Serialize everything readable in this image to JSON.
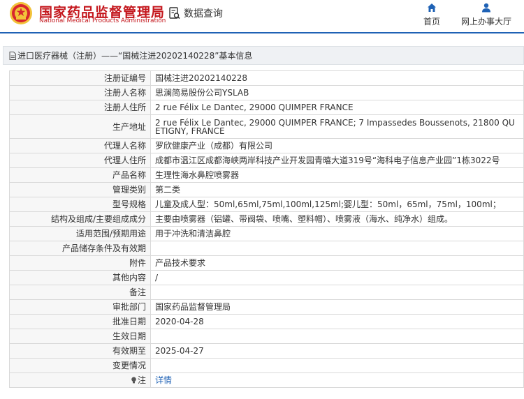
{
  "header": {
    "org_cn": "国家药品监督管理局",
    "org_en": "National Medical Products Administration",
    "query_label": "数据查询",
    "nav_home": "首页",
    "nav_service": "网上办事大厅",
    "accent_color": "#c4161c",
    "nav_color": "#1f62b5"
  },
  "titlebar": {
    "text": "进口医疗器械（注册）——“国械注进20202140228”基本信息"
  },
  "rows": [
    {
      "label": "注册证编号",
      "value": "国械注进20202140228"
    },
    {
      "label": "注册人名称",
      "value": "思澜简易股份公司YSLAB"
    },
    {
      "label": "注册人住所",
      "value": "2 rue Félix Le Dantec, 29000 QUIMPER FRANCE"
    },
    {
      "label": "生产地址",
      "value": "2 rue Félix Le Dantec, 29000 QUIMPER FRANCE; 7 Impassedes Boussenots, 21800 QUETIGNY, FRANCE"
    },
    {
      "label": "代理人名称",
      "value": "罗欣健康产业（成都）有限公司"
    },
    {
      "label": "代理人住所",
      "value": "成都市温江区成都海峡两岸科技产业开发园青暿大道319号“海科电子信息产业园”1栋3022号"
    },
    {
      "label": "产品名称",
      "value": "生理性海水鼻腔喷雾器"
    },
    {
      "label": "管理类别",
      "value": "第二类"
    },
    {
      "label": "型号规格",
      "value": "儿童及成人型：50ml,65ml,75ml,100ml,125ml;婴儿型：50ml，65ml，75ml，100ml；"
    },
    {
      "label": "结构及组成/主要组成成分",
      "value": "主要由喷雾器（铝罐、带阀袋、喷嘴、塑料帽）、喷雾液（海水、纯净水）组成。"
    },
    {
      "label": "适用范围/预期用途",
      "value": "用于冲洗和清洁鼻腔"
    },
    {
      "label": "产品储存条件及有效期",
      "value": ""
    },
    {
      "label": "附件",
      "value": "产品技术要求"
    },
    {
      "label": "其他内容",
      "value": "/"
    },
    {
      "label": "备注",
      "value": ""
    },
    {
      "label": "审批部门",
      "value": "国家药品监督管理局"
    },
    {
      "label": "批准日期",
      "value": "2020-04-28"
    },
    {
      "label": "生效日期",
      "value": ""
    },
    {
      "label": "有效期至",
      "value": "2025-04-27"
    },
    {
      "label": "变更情况",
      "value": ""
    }
  ],
  "note": {
    "label": "注",
    "link": "详情",
    "icon": "lightbulb-icon"
  }
}
